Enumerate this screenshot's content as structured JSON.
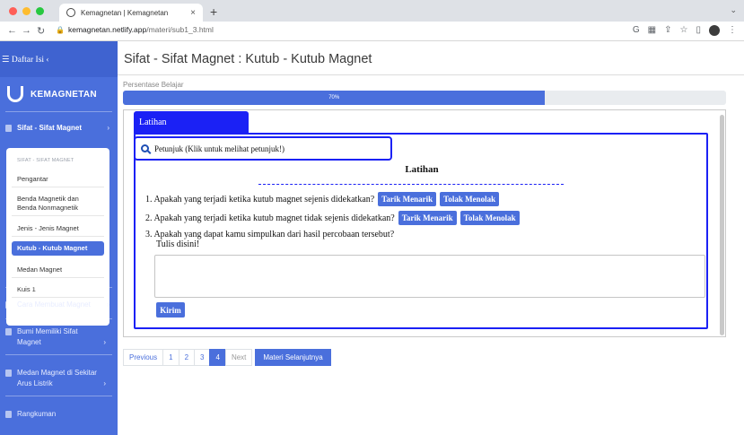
{
  "browser": {
    "tab_title": "Kemagnetan | Kemagnetan",
    "tab_close": "×",
    "new_tab": "+",
    "tab_menu": "⌄",
    "url_host": "kemagnetan.netlify.app",
    "url_path": "/materi/sub1_3.html",
    "traffic_colors": [
      "#ff5f57",
      "#febc2e",
      "#28c840"
    ]
  },
  "sidebar": {
    "header": "☰ Daftar Isi ‹",
    "brand": "KEMAGNETAN",
    "active_section": {
      "label": "Sifat - Sifat Magnet",
      "chevron": "›",
      "subheader": "SIFAT - SIFAT MAGNET",
      "items": [
        "Pengantar",
        "Benda Magnetik dan Benda Nonmagnetik",
        "Jenis - Jenis Magnet",
        "Kutub - Kutub Magnet",
        "Medan Magnet",
        "Kuis 1"
      ],
      "active_item_index": 3
    },
    "sections": [
      {
        "label": "Cara Membuat Magnet",
        "chevron": "›"
      },
      {
        "label": "Bumi Memiliki Sifat Magnet",
        "chevron": "›"
      },
      {
        "label": "Medan Magnet di Sekitar Arus Listrik",
        "chevron": "›"
      },
      {
        "label": "Rangkuman",
        "chevron": ""
      }
    ]
  },
  "main": {
    "title": "Sifat - Sifat Magnet : Kutub - Kutub Magnet",
    "progress_label": "Persentase Belajar",
    "progress_text": "70%",
    "progress_value": 0.7,
    "tab_label": "Latihan",
    "hint": "Petunjuk (Klik untuk melihat petunjuk!)",
    "heading": "Latihan",
    "questions": [
      {
        "text": "1. Apakah yang terjadi ketika kutub magnet sejenis didekatkan?",
        "options": [
          "Tarik Menarik",
          "Tolak Menolak"
        ]
      },
      {
        "text": "2. Apakah yang terjadi ketika kutub magnet tidak sejenis didekatkan?",
        "options": [
          "Tarik Menarik",
          "Tolak Menolak"
        ]
      },
      {
        "text": "3. Apakah yang dapat kamu simpulkan dari hasil percobaan tersebut?",
        "options": []
      }
    ],
    "answer_prompt": "Tulis disini!",
    "submit_label": "Kirim"
  },
  "pagination": {
    "previous": "Previous",
    "pages": [
      "1",
      "2",
      "3",
      "4"
    ],
    "active_page": "4",
    "next": "Next",
    "next_material": "Materi Selanjutnya"
  }
}
